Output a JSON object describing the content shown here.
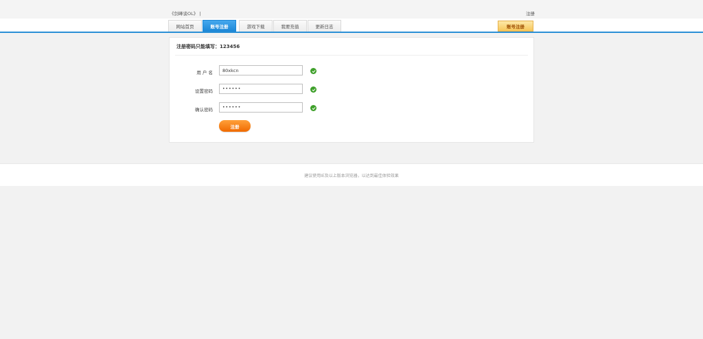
{
  "header": {
    "site_title": "《剑峰谈OL》 |",
    "register_link": "注册"
  },
  "nav": {
    "tabs": [
      {
        "label": "网站首页"
      },
      {
        "label": "账号注册"
      },
      {
        "label": "游戏下载"
      },
      {
        "label": "我要充值"
      },
      {
        "label": "更新日志"
      }
    ],
    "active_index": 1,
    "right_button": "账号注册"
  },
  "form": {
    "heading": "注册密码只能填写：123456",
    "fields": [
      {
        "label": "用 户 名",
        "value": "80xkcn"
      },
      {
        "label": "设置密码",
        "value": "••••••"
      },
      {
        "label": "确认密码",
        "value": "••••••"
      }
    ],
    "submit_label": "注册"
  },
  "footer": {
    "text": "建议使用IE及以上版本浏览器，以达到最佳体验效果"
  },
  "colors": {
    "accent_blue": "#2a8fd6",
    "check_green": "#3fa02b",
    "button_orange": "#f06a00"
  }
}
